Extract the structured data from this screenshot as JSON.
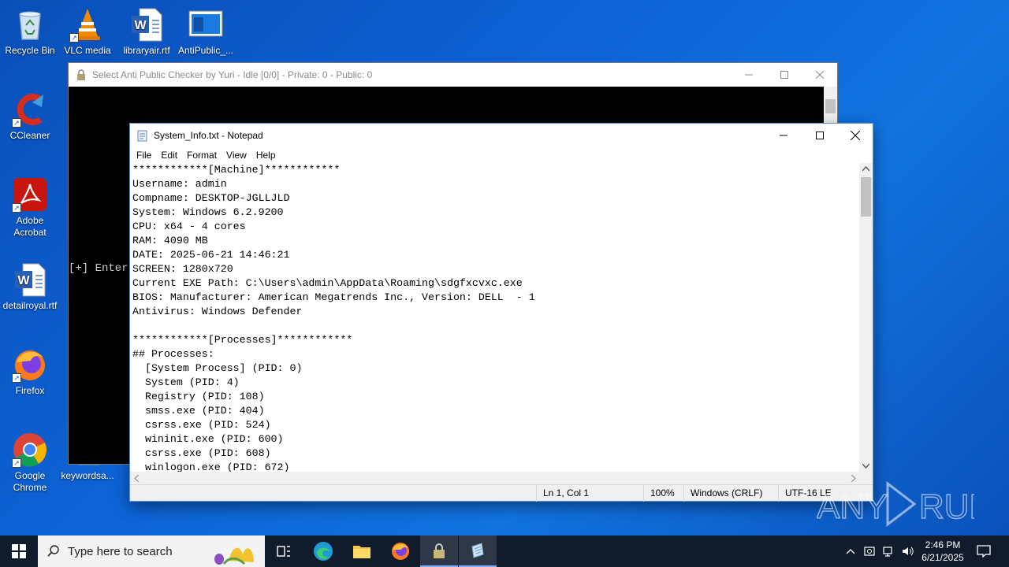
{
  "desktop": {
    "icons": [
      {
        "label": "Recycle Bin",
        "icon": "recycle-bin-icon"
      },
      {
        "label": "VLC media",
        "icon": "vlc-icon"
      },
      {
        "label": "libraryair.rtf",
        "icon": "word-document-icon"
      },
      {
        "label": "AntiPublic_...",
        "icon": "app-window-icon"
      },
      {
        "label": "CCleaner",
        "icon": "ccleaner-icon"
      },
      {
        "label": "Adobe Acrobat",
        "icon": "acrobat-icon"
      },
      {
        "label": "detailroyal.rtf",
        "icon": "word-document-icon"
      },
      {
        "label": "Firefox",
        "icon": "firefox-icon"
      },
      {
        "label": "Google Chrome",
        "icon": "chrome-icon"
      },
      {
        "label": "keywordsa...",
        "icon": "file-icon"
      }
    ]
  },
  "antipublic_window": {
    "title": "Select Anti Public Checker by Yuri - Idle [0/0] - Private: 0 - Public: 0",
    "console_text": "[+] Enter"
  },
  "notepad": {
    "title": "System_Info.txt - Notepad",
    "menu": [
      "File",
      "Edit",
      "Format",
      "View",
      "Help"
    ],
    "lines": [
      "************[Machine]************",
      "Username: admin",
      "Compname: DESKTOP-JGLLJLD",
      "System: Windows 6.2.9200",
      "CPU: x64 - 4 cores",
      "RAM: 4090 MB",
      "DATE: 2025-06-21 14:46:21",
      "SCREEN: 1280x720",
      "Current EXE Path: C:\\Users\\admin\\AppData\\Roaming\\sdgfxcvxc.exe",
      "BIOS: Manufacturer: American Megatrends Inc., Version: DELL  - 1",
      "Antivirus: Windows Defender",
      "",
      "************[Processes]************",
      "## Processes:",
      "  [System Process] (PID: 0)",
      "  System (PID: 4)",
      "  Registry (PID: 108)",
      "  smss.exe (PID: 404)",
      "  csrss.exe (PID: 524)",
      "  wininit.exe (PID: 600)",
      "  csrss.exe (PID: 608)",
      "  winlogon.exe (PID: 672)"
    ],
    "status": {
      "position": "Ln 1, Col 1",
      "zoom": "100%",
      "line_ending": "Windows (CRLF)",
      "encoding": "UTF-16 LE"
    }
  },
  "taskbar": {
    "search_placeholder": "Type here to search",
    "time": "2:46 PM",
    "date": "6/21/2025"
  },
  "watermark": "ANY RUN"
}
